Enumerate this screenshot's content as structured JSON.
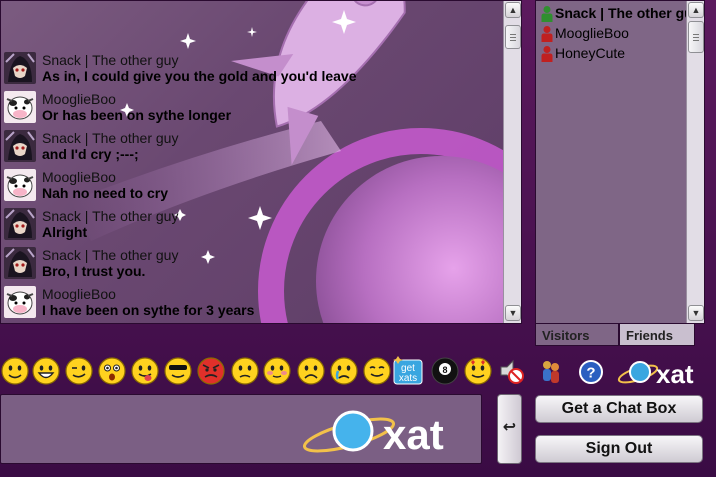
{
  "messages": [
    {
      "name": "Snack | The other guy",
      "text": "As in, I could give you the gold and you'd leave",
      "avatar": "dark-character-avatar"
    },
    {
      "name": "MooglieBoo",
      "text": "Or has been on sythe longer",
      "avatar": "cow-avatar"
    },
    {
      "name": "Snack | The other guy",
      "text": "and I'd cry ;---;",
      "avatar": "dark-character-avatar"
    },
    {
      "name": "MooglieBoo",
      "text": "Nah no need to cry",
      "avatar": "cow-avatar"
    },
    {
      "name": "Snack | The other guy",
      "text": "Alright",
      "avatar": "dark-character-avatar"
    },
    {
      "name": "Snack | The other guy",
      "text": "Bro, I trust you.",
      "avatar": "dark-character-avatar"
    },
    {
      "name": "MooglieBoo",
      "text": "I have been on sythe for 3 years",
      "avatar": "cow-avatar"
    }
  ],
  "users": [
    {
      "name": "Snack | The other guy",
      "status_color": "#2f8f2f",
      "bold": true
    },
    {
      "name": "MooglieBoo",
      "status_color": "#c02020",
      "bold": false
    },
    {
      "name": "HoneyCute",
      "status_color": "#c02020",
      "bold": false
    }
  ],
  "tabs": {
    "visitors": "Visitors",
    "friends": "Friends"
  },
  "smileys": [
    "smile-icon",
    "biggrin-icon",
    "wink-icon",
    "confused-icon",
    "tongue-icon",
    "cool-icon",
    "angry-icon",
    "sad-icon",
    "blush-icon",
    "frown-icon",
    "cry-icon",
    "content-icon",
    "get-xats-icon",
    "eight-ball-icon",
    "hearts-smiley-icon",
    "no-sound-icon"
  ],
  "get_xats": {
    "line1": "get",
    "line2": "xats"
  },
  "eight_ball": "8",
  "buttons": {
    "get_chat_box": "Get a Chat Box",
    "sign_out": "Sign Out",
    "send_glyph": "↩"
  },
  "logo": {
    "text": "xat"
  },
  "help": {
    "glyph": "?"
  },
  "colors": {
    "accent": "#5c1a5e",
    "panel": "#7b5f84",
    "online": "#2f8f2f",
    "offline": "#c02020"
  }
}
